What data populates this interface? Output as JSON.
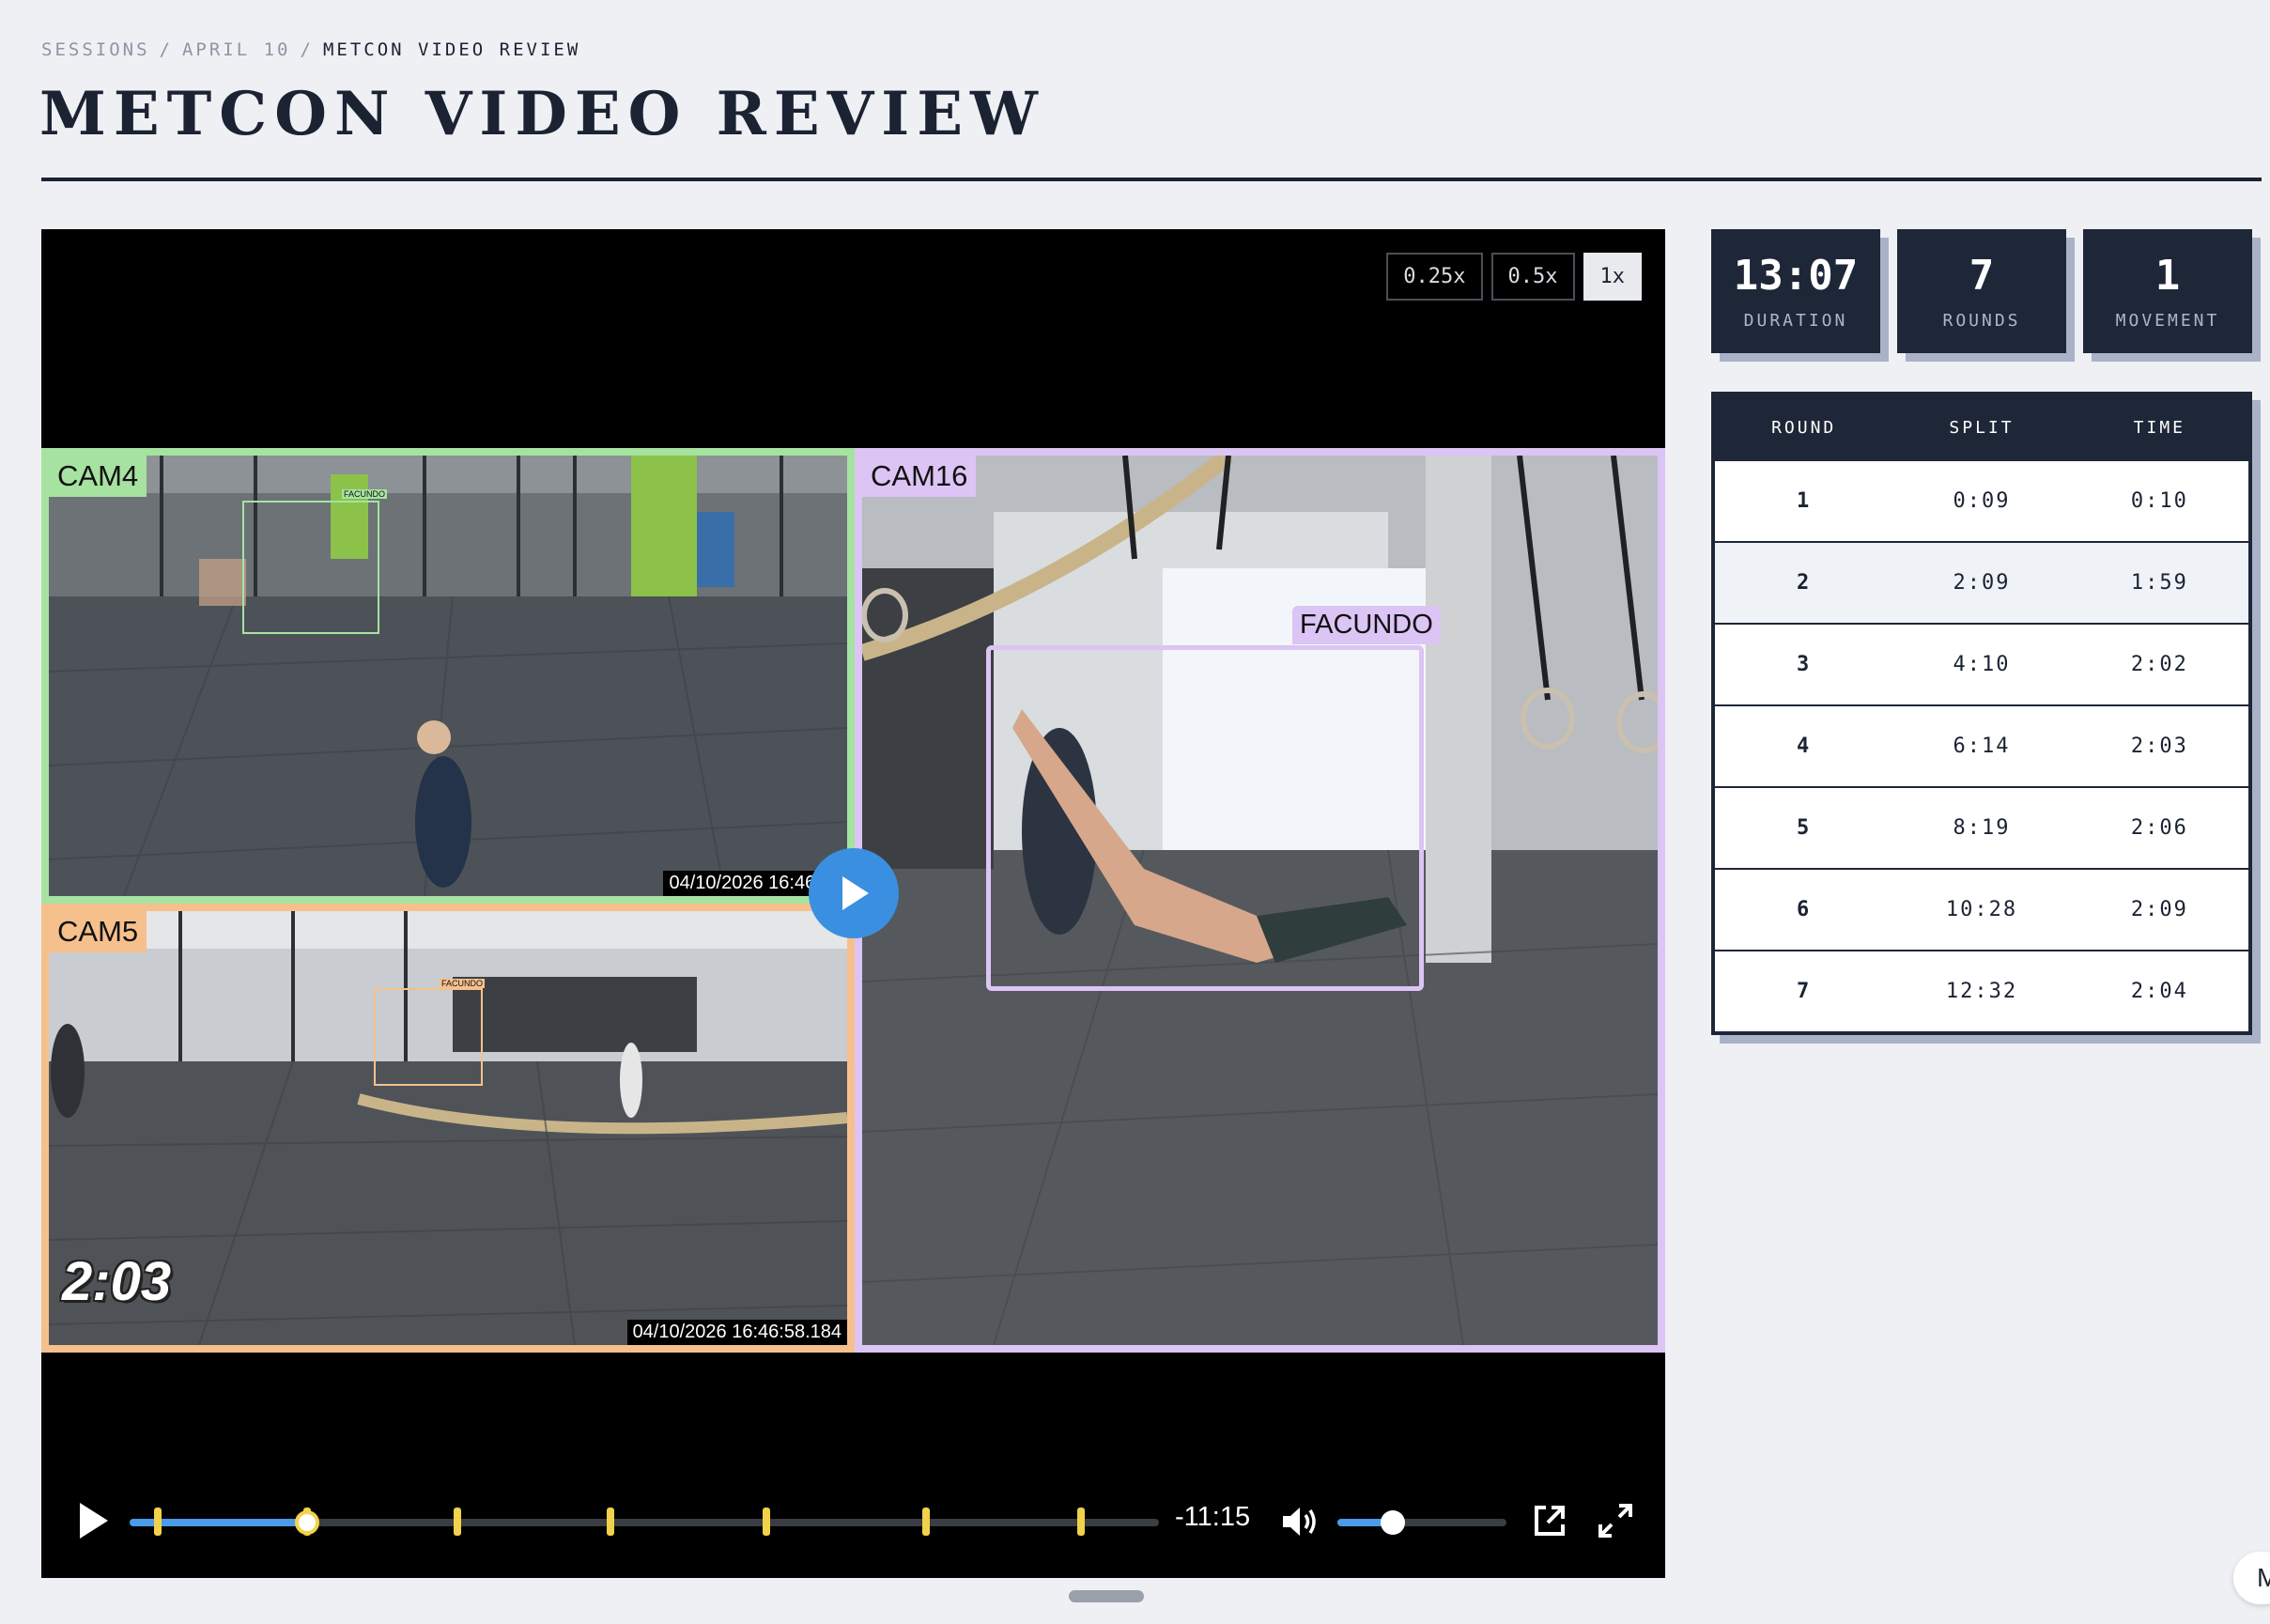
{
  "breadcrumb": {
    "items": [
      "SESSIONS",
      "APRIL 10"
    ],
    "sep": "/",
    "current": "METCON VIDEO REVIEW"
  },
  "page": {
    "title": "METCON VIDEO REVIEW"
  },
  "player": {
    "speeds": [
      {
        "label": "0.25x",
        "active": false
      },
      {
        "label": "0.5x",
        "active": false
      },
      {
        "label": "1x",
        "active": true
      }
    ],
    "cameras": {
      "cam4": {
        "label": "CAM4",
        "timestamp": "04/10/2026 16:46:59",
        "tag": "FACUNDO",
        "color": "#a6e3a1"
      },
      "cam5": {
        "label": "CAM5",
        "timestamp": "04/10/2026 16:46:58.184",
        "tag": "FACUNDO",
        "overlay_time": "2:03",
        "color": "#f6c08d"
      },
      "cam16": {
        "label": "CAM16",
        "tag": "FACUNDO",
        "color": "#dcc4f4"
      }
    },
    "remaining": "-11:15",
    "progress_fraction": 0.172,
    "round_markers_fraction": [
      0.027,
      0.172,
      0.318,
      0.467,
      0.619,
      0.774,
      0.924
    ],
    "volume_fraction": 0.33
  },
  "stats": [
    {
      "value": "13:07",
      "label": "DURATION"
    },
    {
      "value": "7",
      "label": "ROUNDS"
    },
    {
      "value": "1",
      "label": "MOVEMENT"
    }
  ],
  "splits": {
    "headers": [
      "ROUND",
      "SPLIT",
      "TIME"
    ],
    "rows": [
      [
        "1",
        "0:09",
        "0:10"
      ],
      [
        "2",
        "2:09",
        "1:59"
      ],
      [
        "3",
        "4:10",
        "2:02"
      ],
      [
        "4",
        "6:14",
        "2:03"
      ],
      [
        "5",
        "8:19",
        "2:06"
      ],
      [
        "6",
        "10:28",
        "2:09"
      ],
      [
        "7",
        "12:32",
        "2:04"
      ]
    ]
  },
  "corner": {
    "label": "M"
  }
}
